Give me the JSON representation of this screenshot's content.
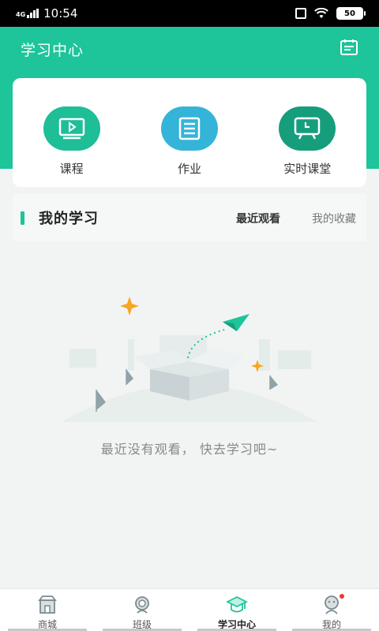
{
  "status_bar": {
    "network": "4G",
    "time": "10:54",
    "battery": "50"
  },
  "header": {
    "title": "学习中心",
    "calendar_icon": "calendar-icon"
  },
  "colors": {
    "brand": "#1ec49a",
    "course": "#1ebe97",
    "homework": "#34b4d8",
    "live": "#169e7c"
  },
  "quick_actions": [
    {
      "label": "课程",
      "icon": "video-play-icon"
    },
    {
      "label": "作业",
      "icon": "document-list-icon"
    },
    {
      "label": "实时课堂",
      "icon": "live-classroom-icon"
    }
  ],
  "my_study": {
    "title": "我的学习",
    "tabs": [
      {
        "label": "最近观看",
        "selected": true
      },
      {
        "label": "我的收藏",
        "selected": false
      }
    ]
  },
  "empty_state": {
    "message": "最近没有观看， 快去学习吧~",
    "illustration": "empty-box-paper-plane"
  },
  "bottom_nav": [
    {
      "label": "商城",
      "icon": "shop-icon",
      "active": false
    },
    {
      "label": "班级",
      "icon": "class-icon",
      "active": false
    },
    {
      "label": "学习中心",
      "icon": "graduation-cap-icon",
      "active": true
    },
    {
      "label": "我的",
      "icon": "profile-icon",
      "active": false,
      "badge": true
    }
  ]
}
